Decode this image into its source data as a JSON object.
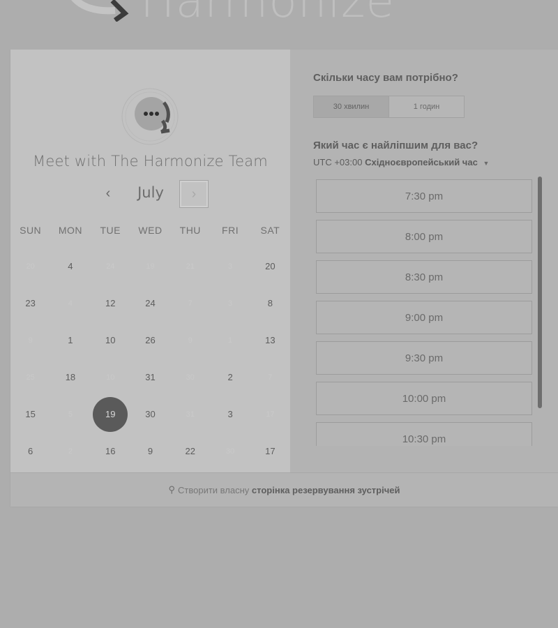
{
  "brand": {
    "name": "Harmonize"
  },
  "organizer": {
    "title": "Meet with The Harmonize Team"
  },
  "calendar": {
    "month": "July",
    "prev_label": "‹",
    "next_label": "›",
    "weekdays": [
      "SUN",
      "MON",
      "TUE",
      "WED",
      "THU",
      "FRI",
      "SAT"
    ],
    "weeks": [
      [
        {
          "d": "20",
          "dim": true
        },
        {
          "d": "4",
          "dim": false
        },
        {
          "d": "24",
          "dim": true
        },
        {
          "d": "19",
          "dim": true
        },
        {
          "d": "21",
          "dim": true
        },
        {
          "d": "3",
          "dim": true
        },
        {
          "d": "20",
          "dim": false
        }
      ],
      [
        {
          "d": "23",
          "dim": false
        },
        {
          "d": "4",
          "dim": true
        },
        {
          "d": "12",
          "dim": false
        },
        {
          "d": "24",
          "dim": false
        },
        {
          "d": "7",
          "dim": true
        },
        {
          "d": "3",
          "dim": true
        },
        {
          "d": "8",
          "dim": false
        }
      ],
      [
        {
          "d": "9",
          "dim": true
        },
        {
          "d": "1",
          "dim": false
        },
        {
          "d": "10",
          "dim": false
        },
        {
          "d": "26",
          "dim": false
        },
        {
          "d": "9",
          "dim": true
        },
        {
          "d": "1",
          "dim": true
        },
        {
          "d": "13",
          "dim": false
        }
      ],
      [
        {
          "d": "25",
          "dim": true
        },
        {
          "d": "18",
          "dim": false
        },
        {
          "d": "10",
          "dim": true
        },
        {
          "d": "31",
          "dim": false
        },
        {
          "d": "30",
          "dim": true
        },
        {
          "d": "2",
          "dim": false
        },
        {
          "d": "7",
          "dim": true
        }
      ],
      [
        {
          "d": "15",
          "dim": false
        },
        {
          "d": "5",
          "dim": true
        },
        {
          "d": "19",
          "dim": false,
          "selected": true
        },
        {
          "d": "30",
          "dim": false
        },
        {
          "d": "31",
          "dim": true
        },
        {
          "d": "3",
          "dim": false
        },
        {
          "d": "17",
          "dim": true
        }
      ],
      [
        {
          "d": "6",
          "dim": false
        },
        {
          "d": "2",
          "dim": true
        },
        {
          "d": "16",
          "dim": false
        },
        {
          "d": "9",
          "dim": false
        },
        {
          "d": "22",
          "dim": false
        },
        {
          "d": "30",
          "dim": true
        },
        {
          "d": "17",
          "dim": false
        }
      ]
    ]
  },
  "booking": {
    "duration_question": "Скільки часу вам потрібно?",
    "durations": [
      {
        "label": "30 хвилин",
        "active": true
      },
      {
        "label": "1 годин",
        "active": false
      }
    ],
    "time_question": "Який час є найліпшим для вас?",
    "timezone_offset": "UTC +03:00",
    "timezone_name": "Східноєвропейський час",
    "slots": [
      "7:30 pm",
      "8:00 pm",
      "8:30 pm",
      "9:00 pm",
      "9:30 pm",
      "10:00 pm",
      "10:30 pm"
    ]
  },
  "footer": {
    "prefix": "Створити власну",
    "link": "сторінка резервування зустрічей"
  },
  "colors": {
    "selected_day": "#5a5a5a",
    "page_background": "#adadad"
  }
}
